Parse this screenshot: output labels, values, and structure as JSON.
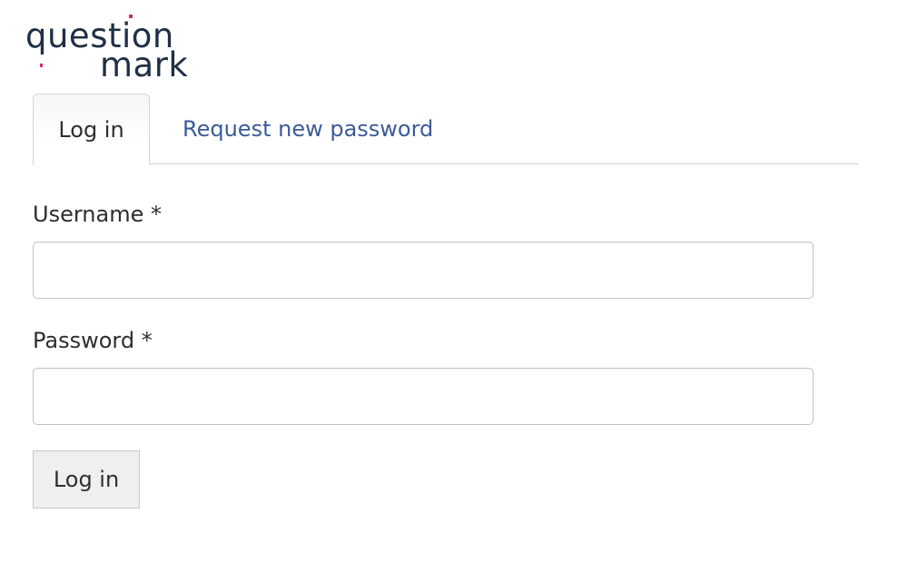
{
  "logo": {
    "line1": "question",
    "line2": "mark",
    "text_color": "#1f2f45",
    "accent_color": "#d12a6c"
  },
  "tabs": {
    "active_label": "Log in",
    "link_label": "Request new password",
    "link_color": "#3b5b98"
  },
  "form": {
    "username_label": "Username *",
    "username_value": "",
    "password_label": "Password *",
    "password_value": "",
    "submit_label": "Log in"
  }
}
